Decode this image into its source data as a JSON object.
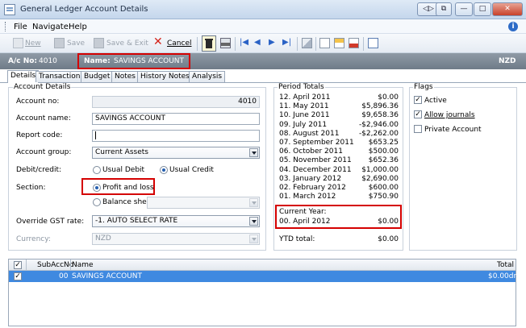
{
  "window": {
    "title": "General Ledger Account Details",
    "btn_back": "◁▷",
    "btn_restore": "⧉",
    "btn_min": "—",
    "btn_max": "□",
    "btn_close": "✕"
  },
  "menu": [
    "File",
    "Navigate",
    "Help"
  ],
  "toolbar": {
    "new": "New",
    "save": "Save",
    "save_exit": "Save & Exit",
    "cancel": "Cancel"
  },
  "header": {
    "ac_label": "A/c No:",
    "ac_value": "4010",
    "name_label": "Name:",
    "name_value": "SAVINGS ACCOUNT",
    "currency": "NZD"
  },
  "tabs": [
    "Details",
    "Transactions",
    "Budget",
    "Notes",
    "History Notes",
    "Analysis"
  ],
  "account": {
    "legend": "Account Details",
    "no_label": "Account no:",
    "no_value": "4010",
    "name_label": "Account name:",
    "name_value": "SAVINGS ACCOUNT",
    "report_label": "Report code:",
    "report_value": "",
    "group_label": "Account group:",
    "group_value": "Current Assets",
    "dc_label": "Debit/credit:",
    "usual_debit": "Usual Debit",
    "usual_credit": "Usual Credit",
    "section_label": "Section:",
    "pl": "Profit and loss",
    "bs": "Balance sheet",
    "bs_value": "",
    "gst_label": "Override GST rate:",
    "gst_value": "-1. AUTO SELECT RATE",
    "currency_label": "Currency:",
    "currency_value": "NZD"
  },
  "period_totals": {
    "legend": "Period Totals",
    "rows": [
      {
        "period": "12. April 2011",
        "value": "$0.00"
      },
      {
        "period": "11. May 2011",
        "value": "$5,896.36"
      },
      {
        "period": "10. June 2011",
        "value": "$9,658.36"
      },
      {
        "period": "09. July 2011",
        "value": "-$2,946.00"
      },
      {
        "period": "08. August 2011",
        "value": "-$2,262.00"
      },
      {
        "period": "07. September 2011",
        "value": "$653.25"
      },
      {
        "period": "06. October 2011",
        "value": "$500.00"
      },
      {
        "period": "05. November 2011",
        "value": "$652.36"
      },
      {
        "period": "04. December 2011",
        "value": "$1,000.00"
      },
      {
        "period": "03. January 2012",
        "value": "$2,690.00"
      },
      {
        "period": "02. February 2012",
        "value": "$600.00"
      },
      {
        "period": "01. March 2012",
        "value": "$750.90"
      }
    ],
    "current_label": "Current Year:",
    "current_period": "00. April 2012",
    "current_value": "$0.00",
    "ytd_label": "YTD total:",
    "ytd_value": "$0.00"
  },
  "flags": {
    "legend": "Flags",
    "active": "Active",
    "allow_journals": "Allow journals",
    "private": "Private Account"
  },
  "grid": {
    "headers": {
      "subacc": "SubAccNo",
      "name": "Name",
      "total": "Total"
    },
    "row": {
      "subacc": "00",
      "name": "SAVINGS ACCOUNT",
      "total": "$0.00dr"
    }
  }
}
